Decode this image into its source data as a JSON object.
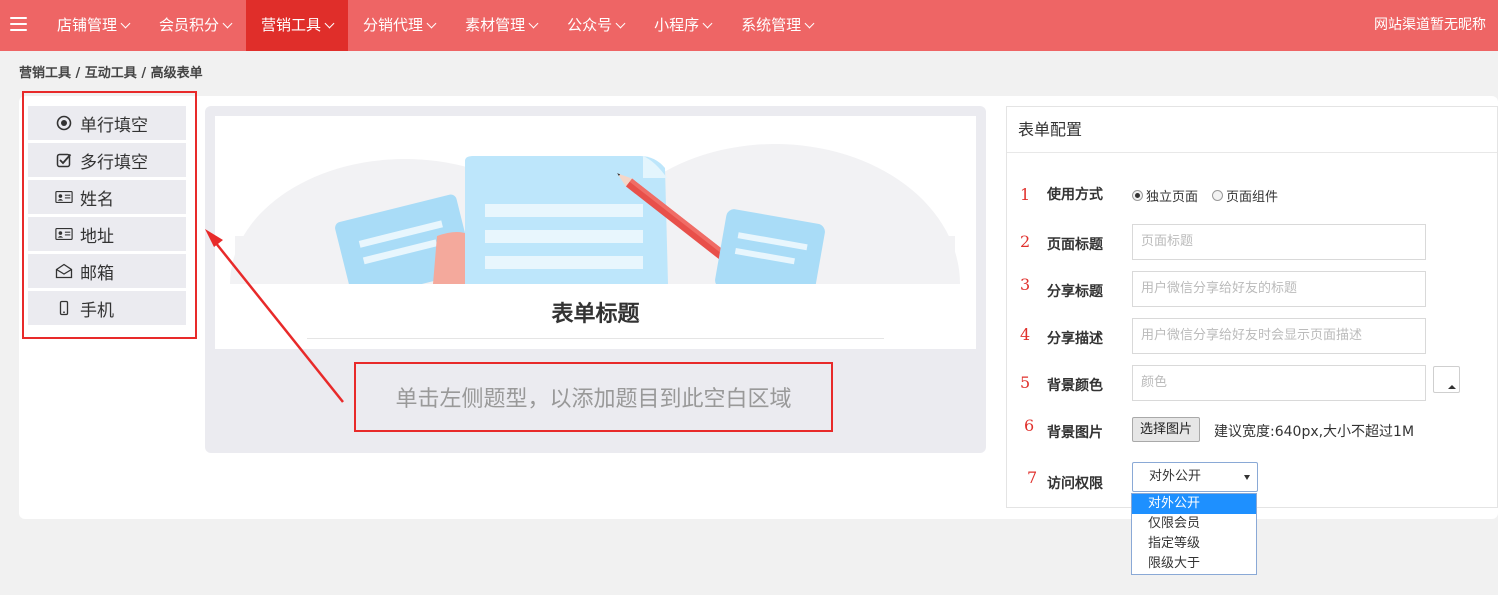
{
  "nav": {
    "items": [
      {
        "label": "店铺管理",
        "active": false
      },
      {
        "label": "会员积分",
        "active": false
      },
      {
        "label": "营销工具",
        "active": true
      },
      {
        "label": "分销代理",
        "active": false
      },
      {
        "label": "素材管理",
        "active": false
      },
      {
        "label": "公众号",
        "active": false
      },
      {
        "label": "小程序",
        "active": false
      },
      {
        "label": "系统管理",
        "active": false
      }
    ],
    "site_name": "网站渠道暂无昵称",
    "accent_color": "#ee6565",
    "active_color": "#e02e2a"
  },
  "breadcrumb": "营销工具 / 互动工具 / 高级表单",
  "question_types": [
    {
      "label": "单行填空",
      "icon": "radio-circle-icon"
    },
    {
      "label": "多行填空",
      "icon": "checkbox-icon"
    },
    {
      "label": "姓名",
      "icon": "id-card-icon"
    },
    {
      "label": "地址",
      "icon": "id-card-icon"
    },
    {
      "label": "邮箱",
      "icon": "envelope-icon"
    },
    {
      "label": "手机",
      "icon": "phone-icon"
    }
  ],
  "preview": {
    "form_title": "表单标题",
    "hint": "单击左侧题型，以添加题目到此空白区域"
  },
  "config": {
    "title": "表单配置",
    "rows": {
      "usage": {
        "num": "1",
        "label": "使用方式",
        "options": [
          "独立页面",
          "页面组件"
        ],
        "selected": "独立页面"
      },
      "page_title": {
        "num": "2",
        "label": "页面标题",
        "placeholder": "页面标题"
      },
      "share_title": {
        "num": "3",
        "label": "分享标题",
        "placeholder": "用户微信分享给好友的标题"
      },
      "share_desc": {
        "num": "4",
        "label": "分享描述",
        "placeholder": "用户微信分享给好友时会显示页面描述"
      },
      "bg_color": {
        "num": "5",
        "label": "背景颜色",
        "placeholder": "颜色"
      },
      "bg_image": {
        "num": "6",
        "label": "背景图片",
        "button": "选择图片",
        "hint": "建议宽度:640px,大小不超过1M"
      },
      "access": {
        "num": "7",
        "label": "访问权限",
        "selected": "对外公开",
        "options": [
          "对外公开",
          "仅限会员",
          "指定等级",
          "限级大于"
        ]
      }
    }
  }
}
